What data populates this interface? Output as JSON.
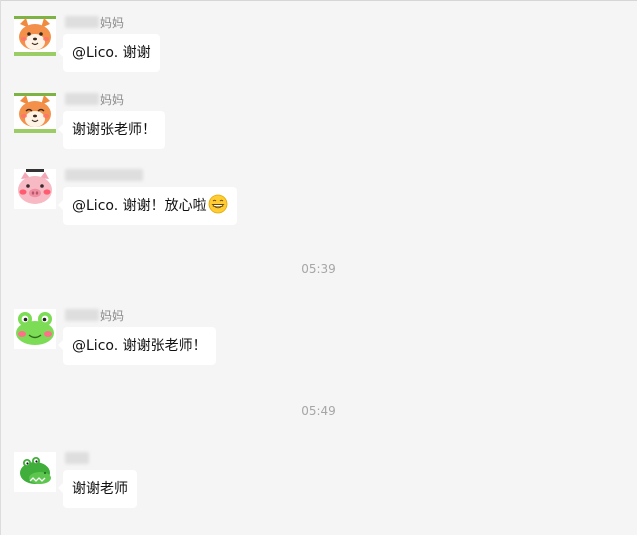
{
  "messages": [
    {
      "sender_suffix": "妈妈",
      "text": "@Lico. 谢谢"
    },
    {
      "sender_suffix": "妈妈",
      "text": "谢谢张老师！"
    },
    {
      "sender_suffix": "",
      "text": "@Lico. 谢谢！放心啦",
      "emoji": "grinning-face-emoji"
    },
    {
      "sender_suffix": "妈妈",
      "text": "@Lico. 谢谢张老师！"
    },
    {
      "sender_suffix": "",
      "text": "谢谢老师"
    }
  ],
  "timestamps": [
    "05:39",
    "05:49"
  ],
  "avatars": [
    "shiba-dog-avatar",
    "shiba-dog-avatar",
    "pink-pig-avatar",
    "green-frog-avatar",
    "crocodile-avatar"
  ],
  "colors": {
    "background": "#f5f5f5",
    "bubble": "#ffffff",
    "timestamp": "#a6a6a6"
  }
}
